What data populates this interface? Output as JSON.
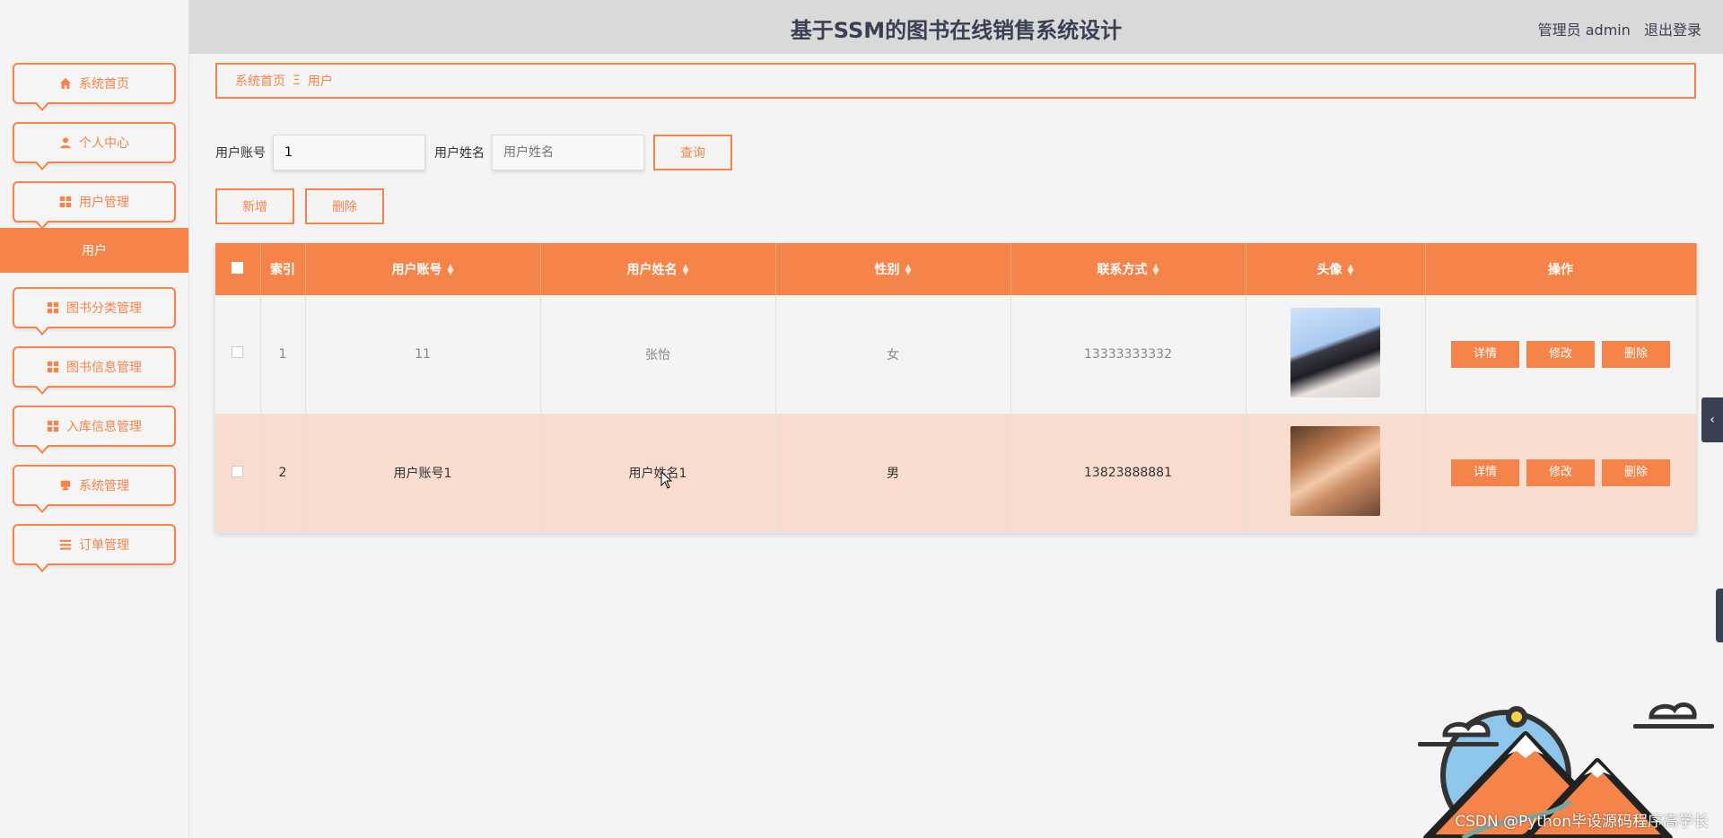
{
  "header": {
    "title": "基于SSM的图书在线销售系统设计",
    "user_label": "管理员 admin",
    "logout_label": "退出登录"
  },
  "sidebar": {
    "items": [
      {
        "label": "系统首页",
        "icon": "home-icon"
      },
      {
        "label": "个人中心",
        "icon": "user-icon"
      },
      {
        "label": "用户管理",
        "icon": "grid-icon"
      },
      {
        "label": "图书分类管理",
        "icon": "grid-icon"
      },
      {
        "label": "图书信息管理",
        "icon": "grid-icon"
      },
      {
        "label": "入库信息管理",
        "icon": "grid-icon"
      },
      {
        "label": "系统管理",
        "icon": "monitor-icon"
      },
      {
        "label": "订单管理",
        "icon": "list-icon"
      }
    ],
    "active_sub": "用户"
  },
  "breadcrumb": {
    "home": "系统首页",
    "separator": "Ξ",
    "current": "用户"
  },
  "search": {
    "account_label": "用户账号",
    "account_value": "1",
    "name_label": "用户姓名",
    "name_placeholder": "用户姓名",
    "query_button": "查询"
  },
  "actions": {
    "add": "新增",
    "delete": "删除"
  },
  "table": {
    "columns": [
      "索引",
      "用户账号",
      "用户姓名",
      "性别",
      "联系方式",
      "头像",
      "操作"
    ],
    "rows": [
      {
        "index": "1",
        "account": "11",
        "name": "张怡",
        "gender": "女",
        "phone": "13333333332"
      },
      {
        "index": "2",
        "account": "用户账号1",
        "name": "用户姓名1",
        "gender": "男",
        "phone": "13823888881"
      }
    ],
    "op_detail": "详情",
    "op_edit": "修改",
    "op_delete": "删除"
  },
  "watermark": "CSDN @Python毕设源码程序高学长",
  "colors": {
    "accent": "#f4844a",
    "header_bg": "#d9d9d9",
    "row_highlight": "#f7dccf"
  }
}
